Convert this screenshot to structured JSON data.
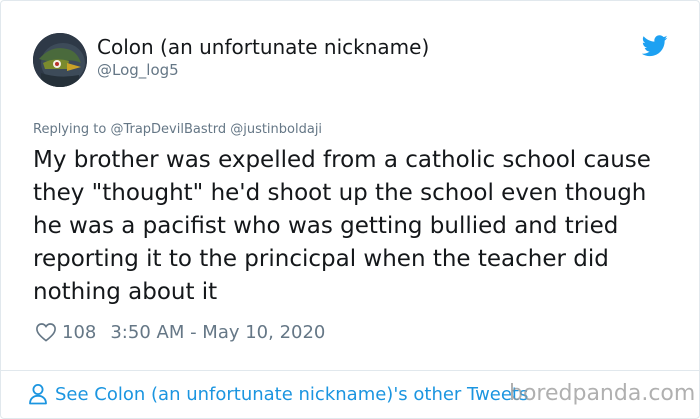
{
  "tweet": {
    "display_name": "Colon (an unfortunate nickname)",
    "handle": "@Log_log5",
    "reply_prefix": "Replying to",
    "reply_to": "@TrapDevilBastrd @justinboldaji",
    "text": "My brother was expelled from a catholic school cause they \"thought\" he'd shoot up the school even though he was a pacifist who was getting bullied and tried reporting it to the princicpal when the teacher did nothing about it",
    "likes": "108",
    "timestamp": "3:50 AM - May 10, 2020"
  },
  "footer": {
    "other_tweets_link": "See Colon (an unfortunate nickname)'s other Tweets"
  },
  "watermark": "boredpanda.com",
  "icons": {
    "brand": "twitter-bird-icon",
    "like": "heart-icon",
    "profile": "person-icon"
  },
  "colors": {
    "twitter_blue": "#1da1f2",
    "link_blue": "#1b95e0",
    "secondary_text": "#657786"
  }
}
